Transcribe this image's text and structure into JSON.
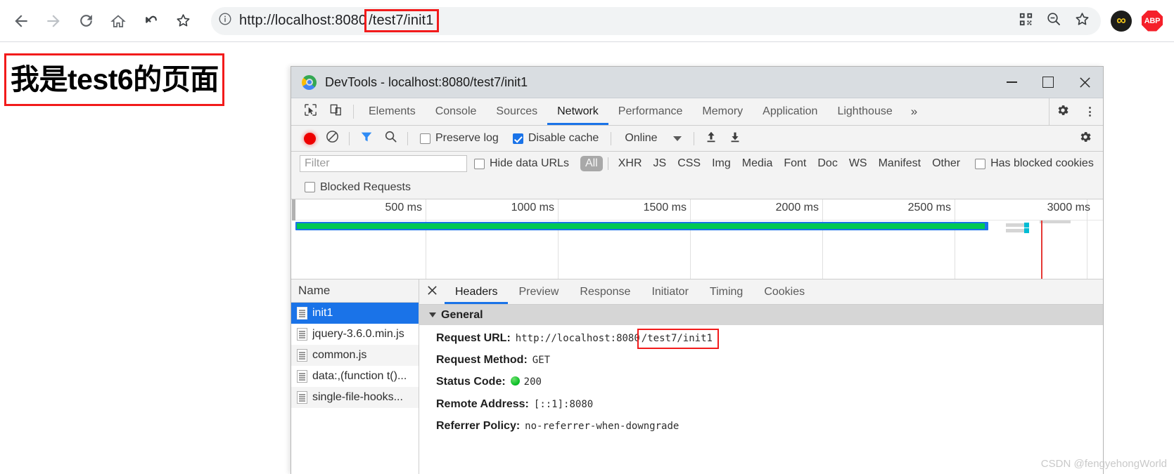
{
  "browser": {
    "nav": {
      "back": "back-arrow",
      "forward": "forward-arrow",
      "reload": "reload",
      "home": "home",
      "undo": "undo",
      "bookmark_star": "star"
    },
    "omnibox": {
      "info_icon": "info-circle",
      "url_prefix": "http://localhost:8080",
      "url_highlight": "/test7/init1",
      "qr_icon": "qr-code-icon",
      "zoom_icon": "zoom-out-icon",
      "star_icon": "star-icon"
    },
    "extensions": [
      {
        "name": "infinity-extension",
        "label": "∞"
      },
      {
        "name": "adblock-plus-extension",
        "label": "ABP"
      }
    ]
  },
  "page": {
    "heading": "我是test6的页面"
  },
  "devtools": {
    "title": "DevTools - localhost:8080/test7/init1",
    "window_controls": {
      "minimize": "—",
      "maximize": "▢",
      "close": "✕"
    },
    "tabs": [
      {
        "label": "Elements",
        "active": false
      },
      {
        "label": "Console",
        "active": false
      },
      {
        "label": "Sources",
        "active": false
      },
      {
        "label": "Network",
        "active": true
      },
      {
        "label": "Performance",
        "active": false
      },
      {
        "label": "Memory",
        "active": false
      },
      {
        "label": "Application",
        "active": false
      },
      {
        "label": "Lighthouse",
        "active": false
      }
    ],
    "tabs_overflow": "»",
    "network_toolbar": {
      "record_title": "record",
      "clear_title": "clear",
      "filter_title": "filter",
      "search_title": "search",
      "preserve_log": {
        "label": "Preserve log",
        "checked": false
      },
      "disable_cache": {
        "label": "Disable cache",
        "checked": true
      },
      "throttling": "Online",
      "import_title": "import-har",
      "export_title": "export-har"
    },
    "filters": {
      "filter_placeholder": "Filter",
      "hide_data_urls": {
        "label": "Hide data URLs",
        "checked": false
      },
      "types": [
        "All",
        "XHR",
        "JS",
        "CSS",
        "Img",
        "Media",
        "Font",
        "Doc",
        "WS",
        "Manifest",
        "Other"
      ],
      "active_type": "All",
      "has_blocked_cookies": {
        "label": "Has blocked cookies",
        "checked": false
      },
      "blocked_requests": {
        "label": "Blocked Requests",
        "checked": false
      }
    },
    "timeline": {
      "ticks": [
        "500 ms",
        "1000 ms",
        "1500 ms",
        "2000 ms",
        "2500 ms",
        "3000 ms"
      ]
    },
    "requests": {
      "column_header": "Name",
      "rows": [
        {
          "name": "init1",
          "selected": true
        },
        {
          "name": "jquery-3.6.0.min.js",
          "selected": false
        },
        {
          "name": "common.js",
          "selected": false
        },
        {
          "name": "data:,(function t()...",
          "selected": false
        },
        {
          "name": "single-file-hooks...",
          "selected": false
        }
      ]
    },
    "details": {
      "close_label": "✕",
      "tabs": [
        {
          "label": "Headers",
          "active": true
        },
        {
          "label": "Preview",
          "active": false
        },
        {
          "label": "Response",
          "active": false
        },
        {
          "label": "Initiator",
          "active": false
        },
        {
          "label": "Timing",
          "active": false
        },
        {
          "label": "Cookies",
          "active": false
        }
      ],
      "section_title": "General",
      "general": [
        {
          "key": "Request URL:",
          "value_prefix": "http://localhost:8080",
          "value_highlight": "/test7/init1"
        },
        {
          "key": "Request Method:",
          "value": "GET"
        },
        {
          "key": "Status Code:",
          "value": "200",
          "status_dot": "#0bbf26"
        },
        {
          "key": "Remote Address:",
          "value": "[::1]:8080"
        },
        {
          "key": "Referrer Policy:",
          "value": "no-referrer-when-downgrade"
        }
      ]
    }
  },
  "watermark": "CSDN @fengyehongWorld",
  "colors": {
    "accent": "#1a73e8",
    "highlight_red": "#f21b1b",
    "timeline_green": "#00c853",
    "timeline_blue": "#1a73e8",
    "status_green": "#0bbf26"
  }
}
